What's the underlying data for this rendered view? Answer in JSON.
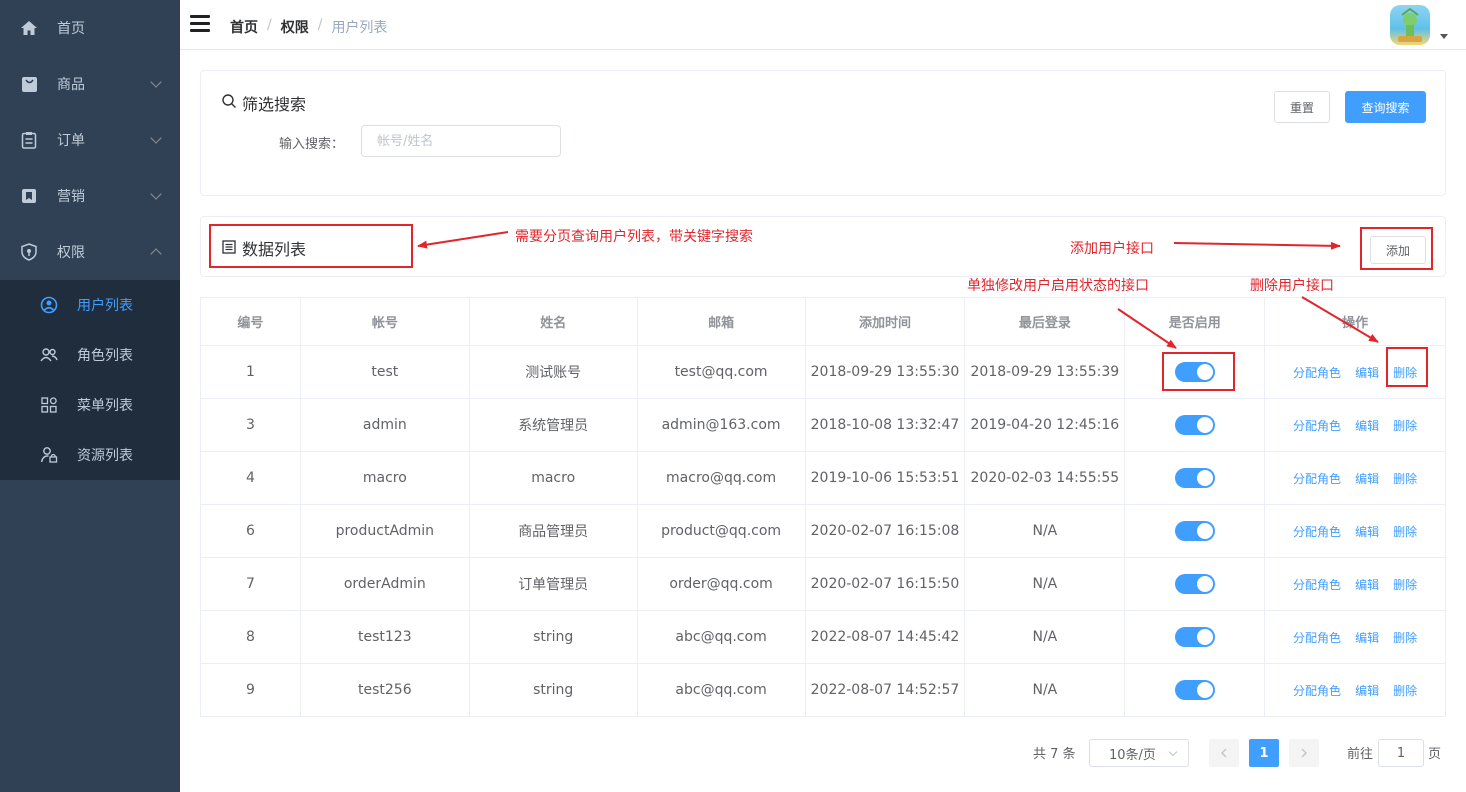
{
  "sidebar": {
    "items": [
      {
        "label": "首页",
        "icon": "home-icon"
      },
      {
        "label": "商品",
        "icon": "shopping-bag-icon"
      },
      {
        "label": "订单",
        "icon": "clipboard-icon"
      },
      {
        "label": "营销",
        "icon": "bookmark-icon"
      },
      {
        "label": "权限",
        "icon": "shield-icon"
      }
    ],
    "sub_items": [
      {
        "label": "用户列表",
        "icon": "user-circle-icon",
        "active": true
      },
      {
        "label": "角色列表",
        "icon": "users-icon"
      },
      {
        "label": "菜单列表",
        "icon": "grid-icon"
      },
      {
        "label": "资源列表",
        "icon": "user-lock-icon"
      }
    ]
  },
  "header": {
    "breadcrumb": [
      "首页",
      "权限",
      "用户列表"
    ],
    "separator": "/"
  },
  "search": {
    "title": "筛选搜索",
    "label": "输入搜索：",
    "placeholder": "帐号/姓名",
    "reset_label": "重置",
    "query_label": "查询搜索"
  },
  "list": {
    "title": "数据列表",
    "add_label": "添加"
  },
  "table": {
    "columns": [
      "编号",
      "帐号",
      "姓名",
      "邮箱",
      "添加时间",
      "最后登录",
      "是否启用",
      "操作"
    ],
    "rows": [
      {
        "id": "1",
        "username": "test",
        "name": "测试账号",
        "email": "test@qq.com",
        "created": "2018-09-29 13:55:30",
        "last_login": "2018-09-29 13:55:39",
        "enabled": true
      },
      {
        "id": "3",
        "username": "admin",
        "name": "系统管理员",
        "email": "admin@163.com",
        "created": "2018-10-08 13:32:47",
        "last_login": "2019-04-20 12:45:16",
        "enabled": true
      },
      {
        "id": "4",
        "username": "macro",
        "name": "macro",
        "email": "macro@qq.com",
        "created": "2019-10-06 15:53:51",
        "last_login": "2020-02-03 14:55:55",
        "enabled": true
      },
      {
        "id": "6",
        "username": "productAdmin",
        "name": "商品管理员",
        "email": "product@qq.com",
        "created": "2020-02-07 16:15:08",
        "last_login": "N/A",
        "enabled": true
      },
      {
        "id": "7",
        "username": "orderAdmin",
        "name": "订单管理员",
        "email": "order@qq.com",
        "created": "2020-02-07 16:15:50",
        "last_login": "N/A",
        "enabled": true
      },
      {
        "id": "8",
        "username": "test123",
        "name": "string",
        "email": "abc@qq.com",
        "created": "2022-08-07 14:45:42",
        "last_login": "N/A",
        "enabled": true
      },
      {
        "id": "9",
        "username": "test256",
        "name": "string",
        "email": "abc@qq.com",
        "created": "2022-08-07 14:52:57",
        "last_login": "N/A",
        "enabled": true
      }
    ],
    "actions": {
      "assign_role": "分配角色",
      "edit": "编辑",
      "delete": "删除"
    }
  },
  "pagination": {
    "total_text": "共 7 条",
    "page_size": "10条/页",
    "current_page": "1",
    "jump_label": "前往",
    "jump_value": "1",
    "jump_unit": "页"
  },
  "annotations": {
    "paged_query": "需要分页查询用户列表，带关键字搜索",
    "add_user": "添加用户接口",
    "toggle_status": "单独修改用户启用状态的接口",
    "delete_user": "删除用户接口"
  },
  "colors": {
    "sidebar_bg": "#304156",
    "submenu_bg": "#1f2d3d",
    "primary": "#409eff",
    "annotation": "#e0262c"
  }
}
